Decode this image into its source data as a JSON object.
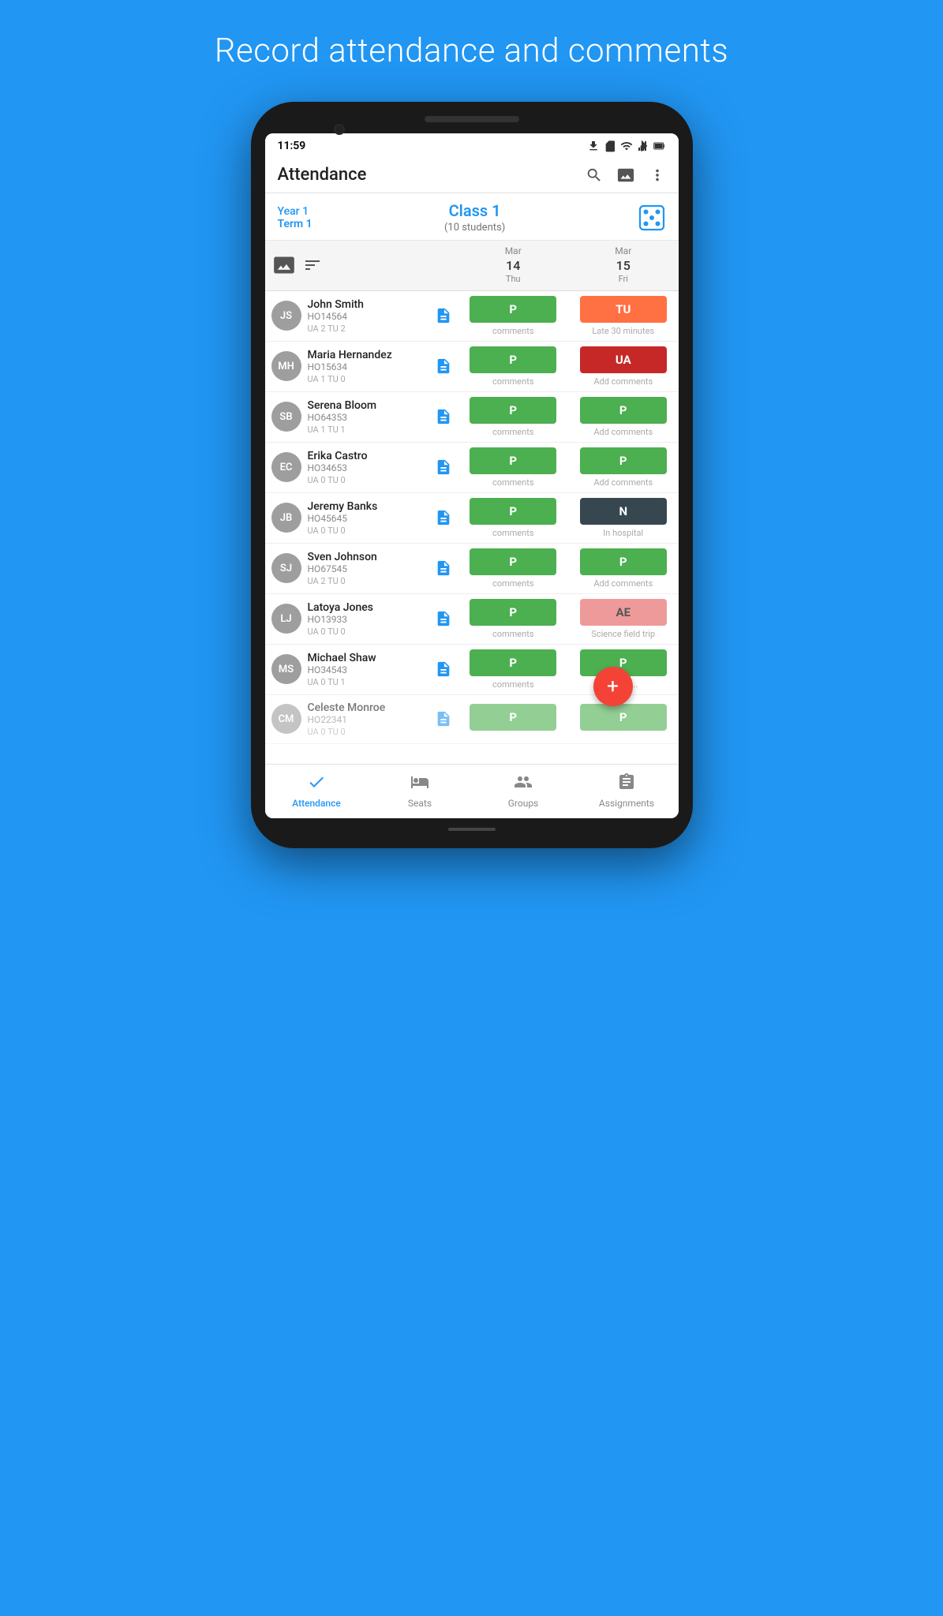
{
  "pageTitle": "Record attendance and comments",
  "statusBar": {
    "time": "11:59",
    "downloadIcon": true,
    "simIcon": true
  },
  "toolbar": {
    "title": "Attendance",
    "searchLabel": "search",
    "imageLabel": "image",
    "moreLabel": "more"
  },
  "classInfo": {
    "year": "Year 1",
    "term": "Term 1",
    "className": "Class 1",
    "studentCount": "(10 students)"
  },
  "dateHeaders": [
    {
      "month": "Mar",
      "day": "14",
      "dayName": "Thu"
    },
    {
      "month": "Mar",
      "day": "15",
      "dayName": "Fri"
    }
  ],
  "students": [
    {
      "initials": "JS",
      "name": "John Smith",
      "id": "HO14564",
      "stats": "UA 2  TU 2",
      "avatarColor": "#9E9E9E",
      "attendance": [
        {
          "badge": "P",
          "badgeClass": "badge-green",
          "comment": "comments"
        },
        {
          "badge": "TU",
          "badgeClass": "badge-orange",
          "comment": "Late 30 minutes"
        }
      ]
    },
    {
      "initials": "MH",
      "name": "Maria Hernandez",
      "id": "HO15634",
      "stats": "UA 1  TU 0",
      "avatarColor": "#9E9E9E",
      "attendance": [
        {
          "badge": "P",
          "badgeClass": "badge-green",
          "comment": "comments"
        },
        {
          "badge": "UA",
          "badgeClass": "badge-red",
          "comment": "Add comments"
        }
      ]
    },
    {
      "initials": "SB",
      "name": "Serena Bloom",
      "id": "HO64353",
      "stats": "UA 1  TU 1",
      "avatarColor": "#9E9E9E",
      "attendance": [
        {
          "badge": "P",
          "badgeClass": "badge-green",
          "comment": "comments"
        },
        {
          "badge": "P",
          "badgeClass": "badge-green",
          "comment": "Add comments"
        }
      ]
    },
    {
      "initials": "EC",
      "name": "Erika Castro",
      "id": "HO34653",
      "stats": "UA 0  TU 0",
      "avatarColor": "#9E9E9E",
      "attendance": [
        {
          "badge": "P",
          "badgeClass": "badge-green",
          "comment": "comments"
        },
        {
          "badge": "P",
          "badgeClass": "badge-green",
          "comment": "Add comments"
        }
      ]
    },
    {
      "initials": "JB",
      "name": "Jeremy Banks",
      "id": "HO45645",
      "stats": "UA 0  TU 0",
      "avatarColor": "#9E9E9E",
      "attendance": [
        {
          "badge": "P",
          "badgeClass": "badge-green",
          "comment": "comments"
        },
        {
          "badge": "N",
          "badgeClass": "badge-navy",
          "comment": "In hospital"
        }
      ]
    },
    {
      "initials": "SJ",
      "name": "Sven Johnson",
      "id": "HO67545",
      "stats": "UA 2  TU 0",
      "avatarColor": "#9E9E9E",
      "attendance": [
        {
          "badge": "P",
          "badgeClass": "badge-green",
          "comment": "comments"
        },
        {
          "badge": "P",
          "badgeClass": "badge-green",
          "comment": "Add comments"
        }
      ]
    },
    {
      "initials": "LJ",
      "name": "Latoya Jones",
      "id": "HO13933",
      "stats": "UA 0  TU 0",
      "avatarColor": "#9E9E9E",
      "attendance": [
        {
          "badge": "P",
          "badgeClass": "badge-green",
          "comment": "comments"
        },
        {
          "badge": "AE",
          "badgeClass": "badge-pink",
          "comment": "Science field trip"
        }
      ]
    },
    {
      "initials": "MS",
      "name": "Michael Shaw",
      "id": "HO34543",
      "stats": "UA 0  TU 1",
      "avatarColor": "#9E9E9E",
      "attendance": [
        {
          "badge": "P",
          "badgeClass": "badge-green",
          "comment": "comments"
        },
        {
          "badge": "P",
          "badgeClass": "badge-green",
          "comment": "Add c..."
        }
      ]
    },
    {
      "initials": "CM",
      "name": "Celeste Monroe",
      "id": "HO22341",
      "stats": "UA 0  TU 0",
      "avatarColor": "#9E9E9E",
      "attendance": [
        {
          "badge": "P",
          "badgeClass": "badge-green",
          "comment": ""
        },
        {
          "badge": "P",
          "badgeClass": "badge-green",
          "comment": ""
        }
      ],
      "partial": true
    }
  ],
  "bottomNav": [
    {
      "label": "Attendance",
      "active": true,
      "icon": "checkmark"
    },
    {
      "label": "Seats",
      "active": false,
      "icon": "seats"
    },
    {
      "label": "Groups",
      "active": false,
      "icon": "groups"
    },
    {
      "label": "Assignments",
      "active": false,
      "icon": "assignments"
    }
  ],
  "fab": "+"
}
